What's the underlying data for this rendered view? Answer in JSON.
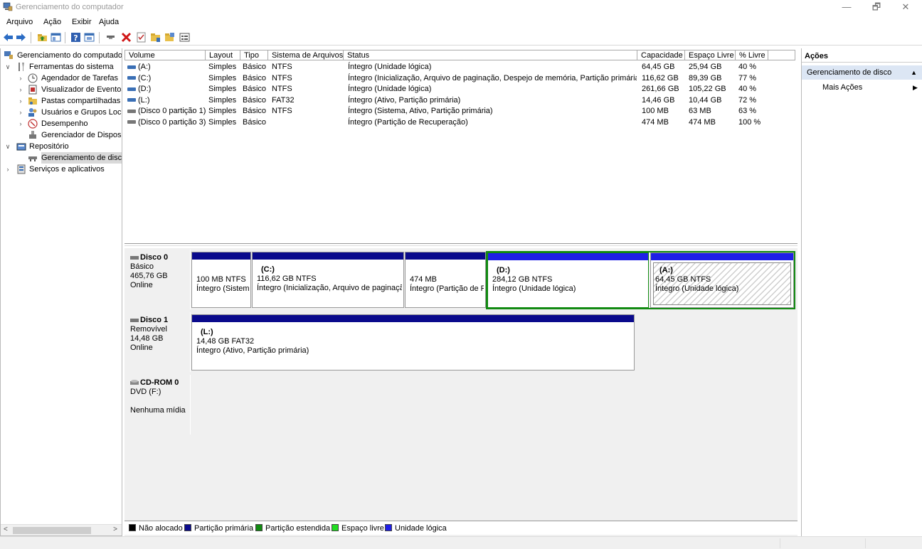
{
  "window": {
    "title": "Gerenciamento do computador",
    "min": "—",
    "max": "🗗",
    "close": "✕"
  },
  "menu": [
    "Arquivo",
    "Ação",
    "Exibir",
    "Ajuda"
  ],
  "tree": {
    "root": "Gerenciamento do computado",
    "system_tools": "Ferramentas do sistema",
    "items": [
      "Agendador de Tarefas",
      "Visualizador de Eventos",
      "Pastas compartilhadas",
      "Usuários e Grupos Loca",
      "Desempenho",
      "Gerenciador de Disposit"
    ],
    "storage": "Repositório",
    "disk_mgmt": "Gerenciamento de disco",
    "services": "Serviços e aplicativos"
  },
  "columns": [
    "Volume",
    "Layout",
    "Tipo",
    "Sistema de Arquivos",
    "Status",
    "Capacidade",
    "Espaço Livre",
    "% Livre"
  ],
  "volumes": [
    {
      "volume": "(A:)",
      "layout": "Simples",
      "tipo": "Básico",
      "fs": "NTFS",
      "status": "Íntegro (Unidade lógica)",
      "cap": "64,45 GB",
      "free": "25,94 GB",
      "pct": "40 %"
    },
    {
      "volume": "(C:)",
      "layout": "Simples",
      "tipo": "Básico",
      "fs": "NTFS",
      "status": "Íntegro (Inicialização, Arquivo de paginação, Despejo de memória, Partição primária)",
      "cap": "116,62 GB",
      "free": "89,39 GB",
      "pct": "77 %"
    },
    {
      "volume": "(D:)",
      "layout": "Simples",
      "tipo": "Básico",
      "fs": "NTFS",
      "status": "Íntegro (Unidade lógica)",
      "cap": "261,66 GB",
      "free": "105,22 GB",
      "pct": "40 %"
    },
    {
      "volume": "(L:)",
      "layout": "Simples",
      "tipo": "Básico",
      "fs": "FAT32",
      "status": "Íntegro (Ativo, Partição primária)",
      "cap": "14,46 GB",
      "free": "10,44 GB",
      "pct": "72 %"
    },
    {
      "volume": "(Disco 0 partição 1)",
      "layout": "Simples",
      "tipo": "Básico",
      "fs": "NTFS",
      "status": "Íntegro (Sistema, Ativo, Partição primária)",
      "cap": "100 MB",
      "free": "63 MB",
      "pct": "63 %"
    },
    {
      "volume": "(Disco 0 partição 3)",
      "layout": "Simples",
      "tipo": "Básico",
      "fs": "",
      "status": "Íntegro (Partição de Recuperação)",
      "cap": "474 MB",
      "free": "474 MB",
      "pct": "100 %"
    }
  ],
  "disks": {
    "disk0": {
      "name": "Disco 0",
      "type": "Básico",
      "size": "465,76 GB",
      "state": "Online",
      "parts": [
        {
          "label": "",
          "size": "100 MB NTFS",
          "status": "Íntegro (Sistem"
        },
        {
          "label": "(C:)",
          "size": "116,62 GB NTFS",
          "status": "Íntegro (Inicialização, Arquivo de paginaçã"
        },
        {
          "label": "",
          "size": "474 MB",
          "status": "Íntegro (Partição de F"
        },
        {
          "label": "(D:)",
          "size": "284,12 GB NTFS",
          "status": "Íntegro (Unidade lógica)"
        },
        {
          "label": "(A:)",
          "size": "64,45 GB NTFS",
          "status": "Íntegro (Unidade lógica)"
        }
      ]
    },
    "disk1": {
      "name": "Disco 1",
      "type": "Removível",
      "size": "14,48 GB",
      "state": "Online",
      "parts": [
        {
          "label": "(L:)",
          "size": "14,48 GB FAT32",
          "status": "Íntegro (Ativo, Partição primária)"
        }
      ]
    },
    "cdrom": {
      "name": "CD-ROM 0",
      "type": "DVD (F:)",
      "state": "Nenhuma mídia"
    }
  },
  "legend": [
    {
      "label": "Não alocado",
      "color": "#000000"
    },
    {
      "label": "Partição primária",
      "color": "#0a0a8c"
    },
    {
      "label": "Partição estendida",
      "color": "#118a11"
    },
    {
      "label": "Espaço livre",
      "color": "#22dd22"
    },
    {
      "label": "Unidade lógica",
      "color": "#1f1fe6"
    }
  ],
  "actions": {
    "header": "Ações",
    "selected": "Gerenciamento de disco",
    "more": "Mais Ações"
  }
}
